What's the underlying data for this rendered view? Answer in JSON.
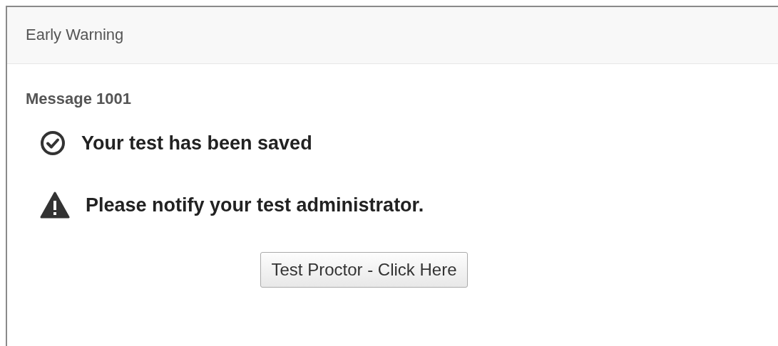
{
  "panel": {
    "title": "Early Warning"
  },
  "message": {
    "heading": "Message 1001",
    "notices": [
      {
        "kind": "success",
        "text": "Your test has been saved"
      },
      {
        "kind": "warning",
        "text": "Please notify your test administrator."
      }
    ],
    "button": {
      "label": "Test Proctor - Click Here"
    }
  }
}
